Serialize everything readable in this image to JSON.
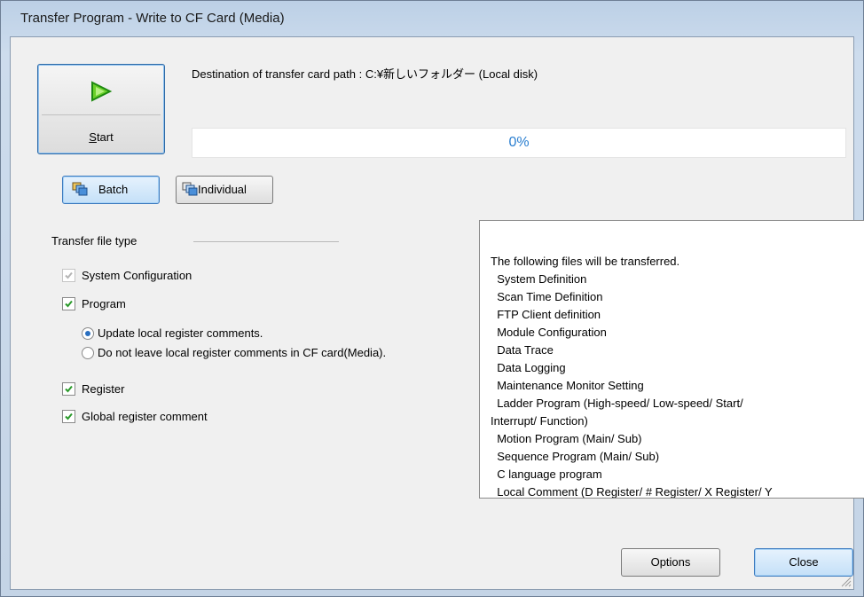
{
  "window": {
    "title": "Transfer Program - Write to CF Card (Media)"
  },
  "start": {
    "label_underlined": "S",
    "label_rest": "tart"
  },
  "destination": {
    "text": "Destination of transfer card path : C:¥新しいフォルダー (Local disk)"
  },
  "progress": {
    "value": 0,
    "text": "0%"
  },
  "mode_buttons": {
    "batch": "Batch",
    "individual": "Individual"
  },
  "transfer_file_type": {
    "label": "Transfer file type",
    "system_configuration": {
      "label": "System Configuration",
      "checked": true,
      "enabled": false
    },
    "program": {
      "label": "Program",
      "checked": true
    },
    "update_comments": {
      "label": "Update local register comments.",
      "selected": true
    },
    "no_comments": {
      "label": "Do not leave local register comments in CF card(Media).",
      "selected": false
    },
    "register": {
      "label": "Register",
      "checked": true
    },
    "global_comment": {
      "label": "Global register comment",
      "checked": true
    }
  },
  "info": {
    "lines": [
      "The following files will be transferred.",
      "  System Definition",
      "  Scan Time Definition",
      "  FTP Client definition",
      "  Module Configuration",
      "  Data Trace",
      "  Data Logging",
      "  Maintenance Monitor Setting",
      "  Ladder Program (High-speed/ Low-speed/ Start/",
      "Interrupt/ Function)",
      "  Motion Program (Main/ Sub)",
      "  Sequence Program (Main/ Sub)",
      "  C language program",
      "  Local Comment (D Register/ # Register/ X Register/ Y"
    ]
  },
  "footer": {
    "options": "Options",
    "close": "Close"
  },
  "colors": {
    "accent": "#3d7bbf",
    "progress_text": "#2b7fd0",
    "check": "#2a9a2a"
  }
}
